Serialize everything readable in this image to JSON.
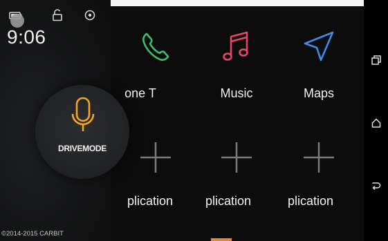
{
  "status": {
    "clock": "9:06",
    "icons": [
      "battery-icon",
      "lock-icon",
      "settings-icon"
    ]
  },
  "drive": {
    "label": "DRIVEMODE",
    "icon": "microphone-icon",
    "accent": "#f5a623"
  },
  "footer": {
    "copyright": "©2014-2015 CARBIT"
  },
  "apps": [
    {
      "label": "one   T",
      "icon": "phone-icon",
      "color": "#35c46a"
    },
    {
      "label": "Music",
      "icon": "music-note-icon",
      "color": "#e8456b"
    },
    {
      "label": "Maps",
      "icon": "navigation-arrow-icon",
      "color": "#3a8ee8"
    },
    {
      "label": "plication",
      "icon": "plus-icon",
      "color": "#7a7a7a"
    },
    {
      "label": "plication",
      "icon": "plus-icon",
      "color": "#7a7a7a"
    },
    {
      "label": "plication",
      "icon": "plus-icon",
      "color": "#7a7a7a"
    }
  ],
  "nav": {
    "buttons": [
      "recent-apps-icon",
      "home-icon",
      "back-icon"
    ]
  }
}
